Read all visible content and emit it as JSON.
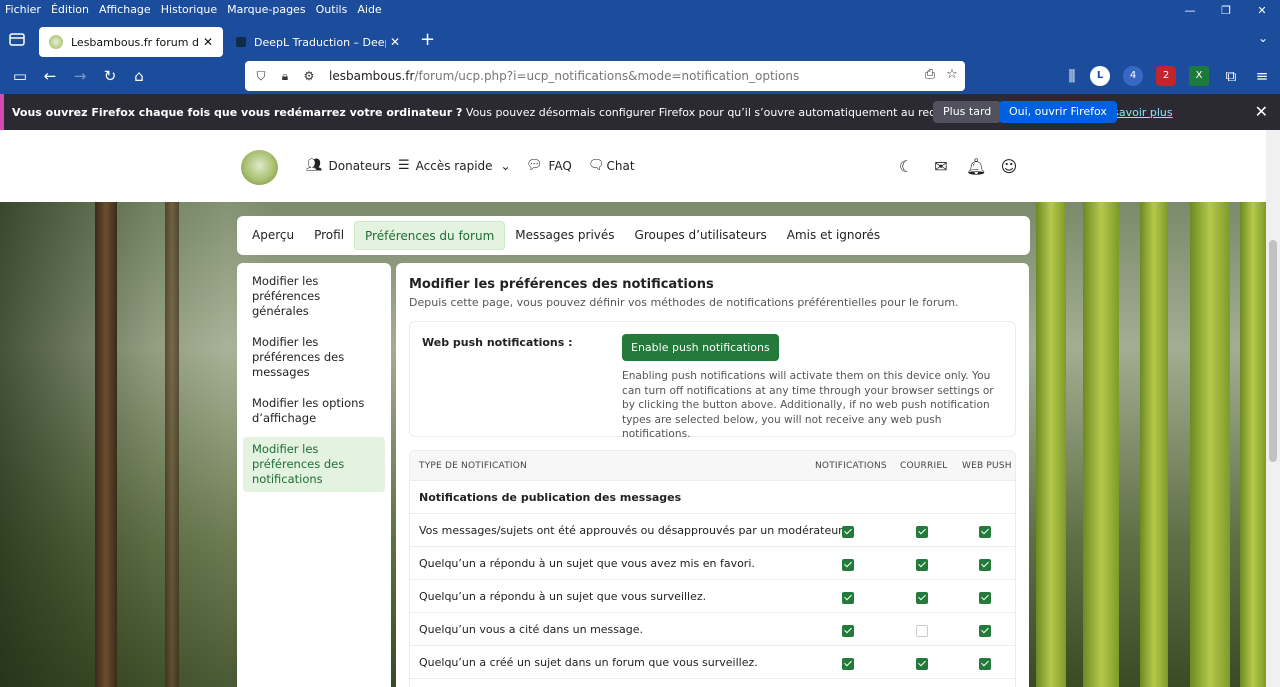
{
  "menubar": {
    "items": [
      "Fichier",
      "Édition",
      "Affichage",
      "Historique",
      "Marque-pages",
      "Outils",
      "Aide"
    ]
  },
  "tabs": [
    {
      "title": "Lesbambous.fr forum des fous",
      "active": true
    },
    {
      "title": "DeepL Traduction – DeepL Trans",
      "active": false
    }
  ],
  "url": {
    "host": "lesbambous.fr",
    "path": "/forum/ucp.php?i=ucp_notifications&mode=notification_options"
  },
  "extensions": {
    "badge1": "4",
    "badge2": "2",
    "badge2_label": "ABP"
  },
  "banner": {
    "question": "Vous ouvrez Firefox chaque fois que vous redémarrez votre ordinateur ?",
    "text": " Vous pouvez désormais configurer Firefox pour qu’il s’ouvre automatiquement au redémarrage de votre appareil.",
    "learn_more": "En savoir plus",
    "later": "Plus tard",
    "ok": "Oui, ouvrir Firefox"
  },
  "site_nav": {
    "donors": "Donateurs",
    "quick": "Accès rapide",
    "faq": "FAQ",
    "chat": "Chat"
  },
  "ucp_tabs": [
    "Aperçu",
    "Profil",
    "Préférences du forum",
    "Messages privés",
    "Groupes d’utilisateurs",
    "Amis et ignorés"
  ],
  "sidebar": [
    "Modifier les préférences générales",
    "Modifier les préférences des messages",
    "Modifier les options d’affichage",
    "Modifier les préférences des notifications"
  ],
  "main": {
    "title": "Modifier les préférences des notifications",
    "desc": "Depuis cette page, vous pouvez définir vos méthodes de notifications préférentielles pour le forum.",
    "push_label": "Web push notifications :",
    "push_button": "Enable push notifications",
    "push_help": "Enabling push notifications will activate them on this device only. You can turn off notifications at any time through your browser settings or by clicking the button above. Additionally, if no web push notification types are selected below, you will not receive any web push notifications."
  },
  "table": {
    "headers": {
      "type": "TYPE DE NOTIFICATION",
      "notif": "NOTIFICATIONS",
      "mail": "COURRIEL",
      "push": "WEB PUSH"
    },
    "section": "Notifications de publication des messages",
    "rows": [
      {
        "label": "Vos messages/sujets ont été approuvés ou désapprouvés par un modérateur.",
        "checks": [
          true,
          true,
          true
        ]
      },
      {
        "label": "Quelqu’un a répondu à un sujet que vous avez mis en favori.",
        "checks": [
          true,
          true,
          true
        ]
      },
      {
        "label": "Quelqu’un a répondu à un sujet que vous surveillez.",
        "checks": [
          true,
          true,
          true
        ]
      },
      {
        "label": "Quelqu’un vous a cité dans un message.",
        "checks": [
          true,
          false,
          true
        ]
      },
      {
        "label": "Quelqu’un a créé un sujet dans un forum que vous surveillez.",
        "checks": [
          true,
          true,
          true
        ]
      }
    ]
  }
}
